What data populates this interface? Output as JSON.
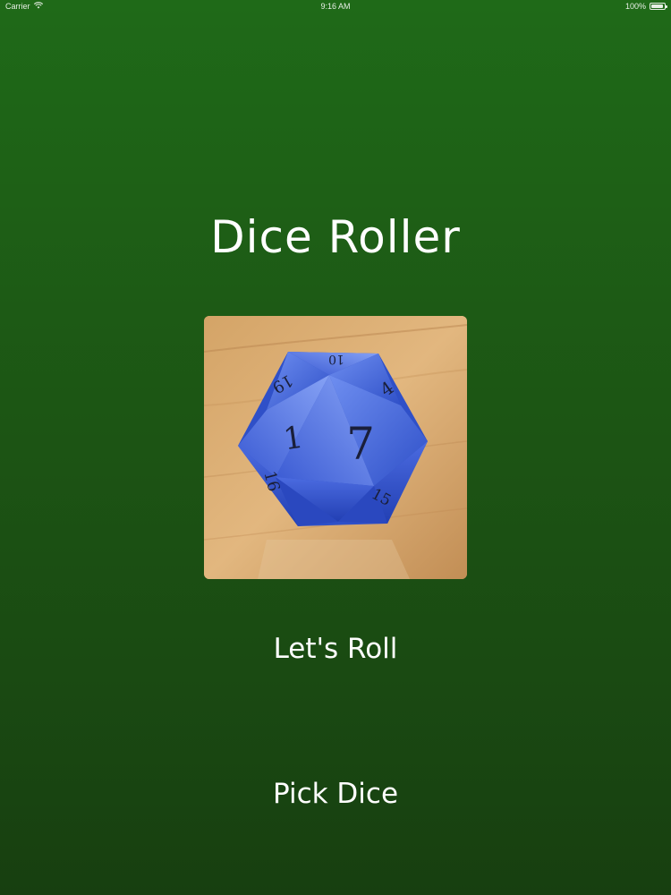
{
  "status_bar": {
    "carrier": "Carrier",
    "time": "9:16 AM",
    "battery": "100%",
    "battery_level_percent": 100
  },
  "app": {
    "title": "Dice Roller"
  },
  "dice": {
    "type": "d20",
    "color": "#3f63d6",
    "faces": {
      "center_left": "1",
      "center_right": "7",
      "top": "10",
      "top_right": "4",
      "top_left": "19",
      "bottom_left": "16",
      "bottom_right": "15"
    }
  },
  "buttons": {
    "roll_label": "Let's Roll",
    "pick_label": "Pick Dice"
  }
}
